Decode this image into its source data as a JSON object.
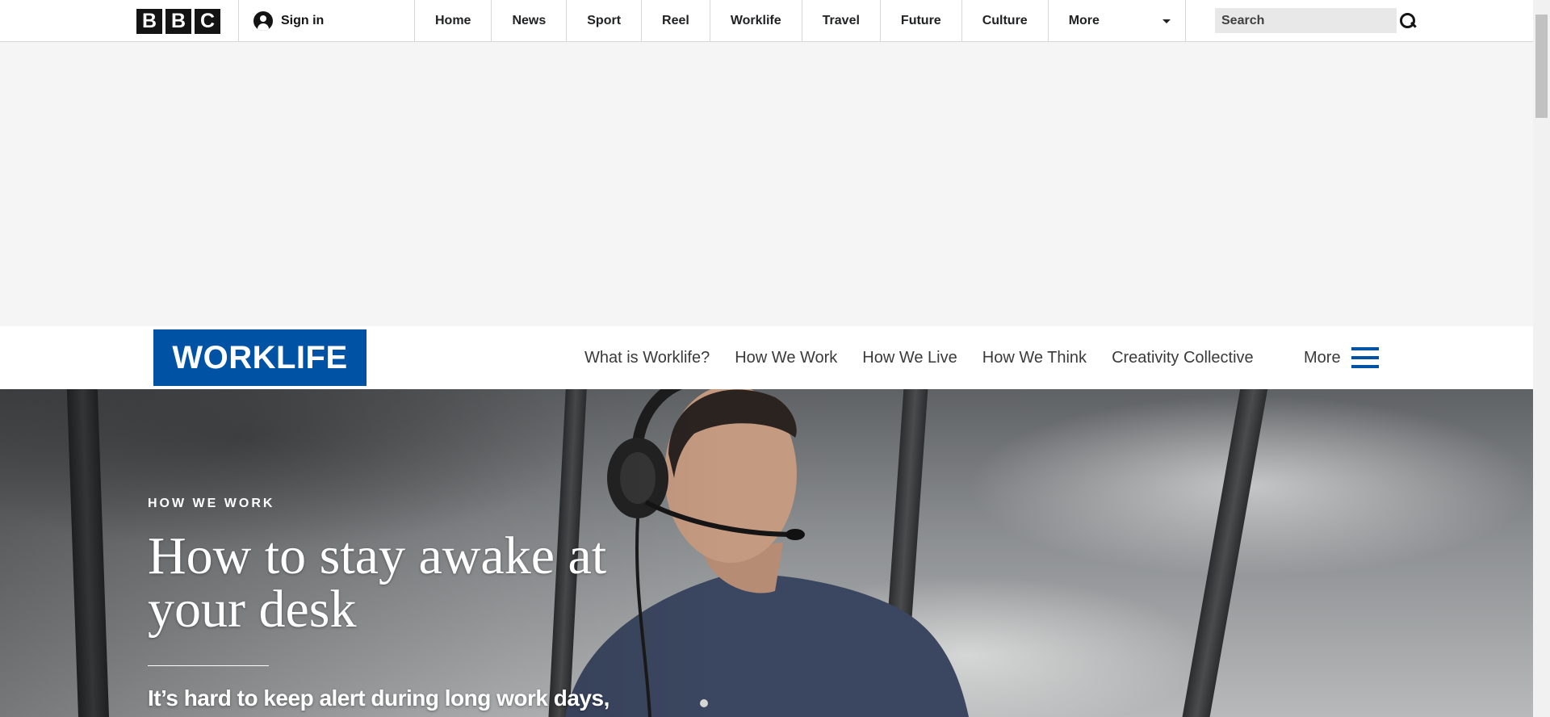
{
  "brand": {
    "logo_letters": [
      "B",
      "B",
      "C"
    ]
  },
  "account": {
    "signin_label": "Sign in"
  },
  "top_nav": {
    "items": [
      "Home",
      "News",
      "Sport",
      "Reel",
      "Worklife",
      "Travel",
      "Future",
      "Culture"
    ],
    "more_label": "More"
  },
  "search": {
    "placeholder": "Search"
  },
  "section": {
    "logo_text": "WORKLIFE",
    "links": [
      "What is Worklife?",
      "How We Work",
      "How We Live",
      "How We Think",
      "Creativity Collective"
    ],
    "more_label": "More",
    "accent_color": "#0052a5"
  },
  "hero": {
    "kicker": "HOW WE WORK",
    "headline": "How to stay awake at your desk",
    "standfirst": "It’s hard to keep alert during long work days,"
  },
  "icons": [
    "user-icon",
    "chevron-down-icon",
    "search-icon",
    "hamburger-icon"
  ]
}
